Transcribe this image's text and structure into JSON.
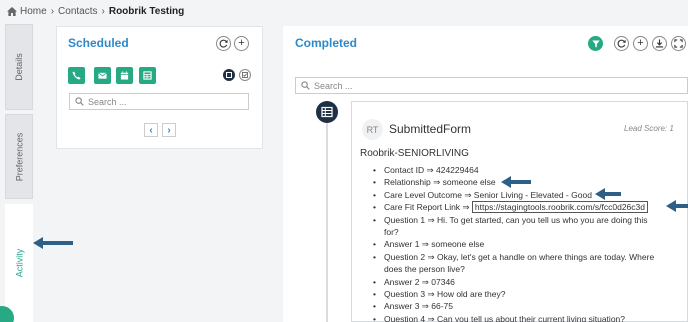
{
  "breadcrumb": {
    "home": "Home",
    "contacts": "Contacts",
    "current": "Roobrik Testing",
    "separator": "›"
  },
  "tabs": [
    {
      "label": "Details"
    },
    {
      "label": "Preferences"
    },
    {
      "label": "Activity"
    }
  ],
  "scheduled": {
    "title": "Scheduled",
    "search_placeholder": "Search ...",
    "prev": "‹",
    "next": "›",
    "add": "+"
  },
  "completed": {
    "title": "Completed",
    "search_placeholder": "Search ...",
    "add": "+"
  },
  "form": {
    "avatar": "RT",
    "title": "SubmittedForm",
    "lead_score": "Lead Score: 1",
    "name": "Roobrik-SENIORLIVING",
    "fields": [
      {
        "text": "Contact ID ⇒ 424229464"
      },
      {
        "text": "Relationship ⇒ someone else"
      },
      {
        "text": "Care Level Outcome ⇒ Senior Living - Elevated - Good"
      },
      {
        "label": "Care Fit Report Link ⇒ ",
        "link": "https://stagingtools.roobrik.com/s/fcc0d26c3d"
      },
      {
        "text": "Question 1 ⇒ Hi. To get started, can you tell us who you are doing this"
      },
      {
        "text": "for?"
      },
      {
        "text": "Answer 1 ⇒ someone else"
      },
      {
        "text": "Question 2 ⇒ Okay, let's get a handle on where things are today. Where"
      },
      {
        "text": "does the person live?"
      },
      {
        "text": "Answer 2 ⇒ 07346"
      },
      {
        "text": "Question 3 ⇒ How old are they?"
      },
      {
        "text": "Answer 3 ⇒ 66-75"
      },
      {
        "text": "Question 4 ⇒ Can you tell us about their current living situation?"
      }
    ]
  },
  "colors": {
    "accent_green": "#27a984",
    "title_blue": "#2d89c8",
    "arrow_blue": "#2e5f86",
    "timeline_icon": "#1f2f44"
  },
  "icons": [
    "home-icon",
    "refresh-icon",
    "plus-icon",
    "phone-icon",
    "mail-icon",
    "calendar-icon",
    "grid-icon",
    "search-icon",
    "filter-icon",
    "download-icon",
    "table-icon"
  ]
}
